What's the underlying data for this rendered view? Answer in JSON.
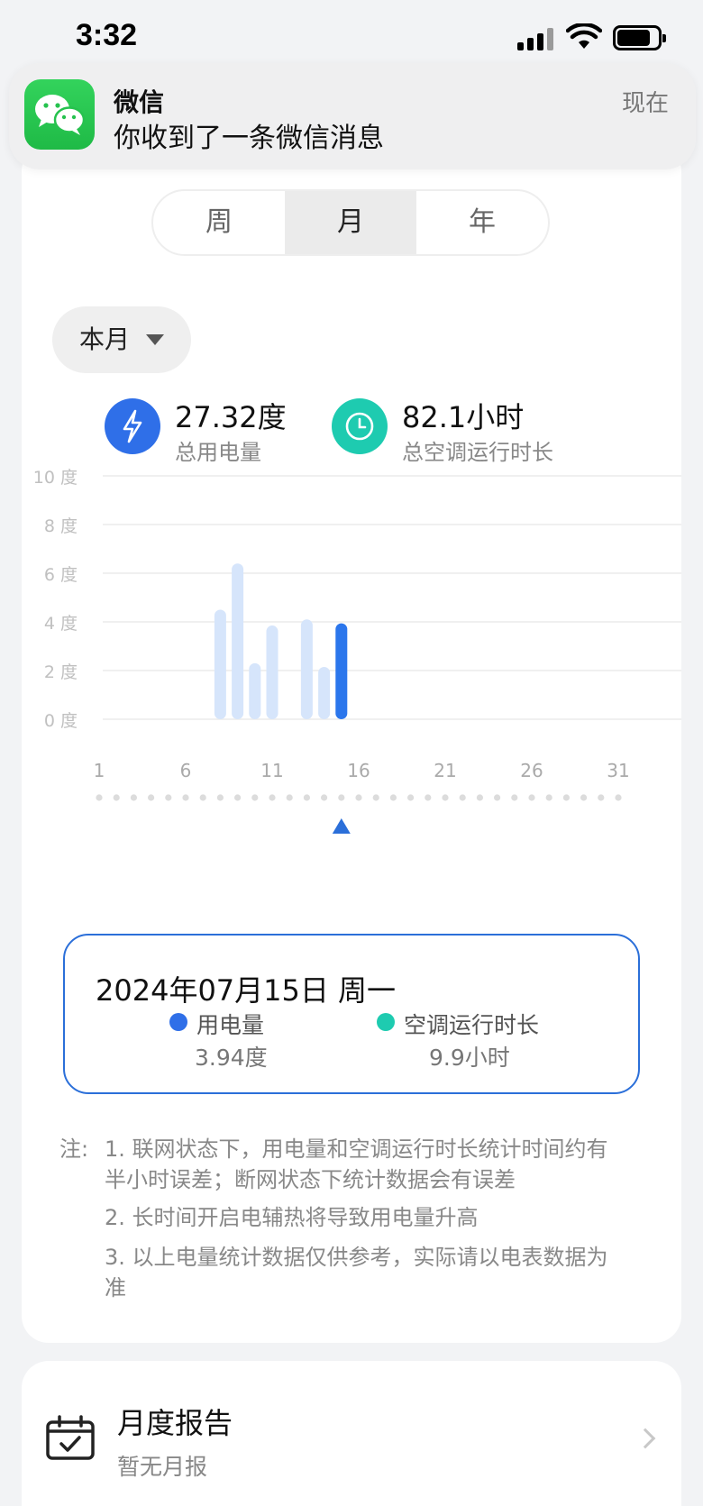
{
  "status_bar": {
    "time": "3:32"
  },
  "notification": {
    "app": "微信",
    "message": "你收到了一条微信消息",
    "time": "现在",
    "icon": "wechat-icon"
  },
  "tabs": [
    {
      "label": "周",
      "active": false
    },
    {
      "label": "月",
      "active": true
    },
    {
      "label": "年",
      "active": false
    }
  ],
  "period_selector": {
    "label": "本月",
    "icon": "caret-down-icon"
  },
  "stats": {
    "power": {
      "value": "27.32度",
      "label": "总用电量",
      "icon": "lightning-icon",
      "color": "#2f6fe8"
    },
    "runtime": {
      "value": "82.1小时",
      "label": "总空调运行时长",
      "icon": "clock-icon",
      "color": "#1ecbb0"
    }
  },
  "chart_data": {
    "type": "bar",
    "y_ticks": [
      "10 度",
      "8 度",
      "6 度",
      "4 度",
      "2 度",
      "0 度"
    ],
    "ylim": [
      0,
      10
    ],
    "x_ticks": [
      "1",
      "6",
      "11",
      "16",
      "21",
      "26",
      "31"
    ],
    "xlim": [
      1,
      31
    ],
    "x": [
      8,
      9,
      10,
      11,
      13,
      14,
      15
    ],
    "values": [
      4.5,
      6.4,
      2.3,
      3.85,
      4.1,
      2.15,
      3.94
    ],
    "selected_day": 15,
    "colors": {
      "normal": "#d6e5fb",
      "selected": "#2b76ec",
      "grid": "#ececec",
      "tick": "#c0c0c0",
      "marker": "#2b6fd9"
    }
  },
  "detail": {
    "date": "2024年07月15日  周一",
    "power_label": "用电量",
    "power_value": "3.94度",
    "power_color": "#2f6fe8",
    "runtime_label": "空调运行时长",
    "runtime_value": "9.9小时",
    "runtime_color": "#1ecbb0"
  },
  "notes": {
    "prefix": "注:",
    "items": [
      "1. 联网状态下，用电量和空调运行时长统计时间约有半小时误差；断网状态下统计数据会有误差",
      "2. 长时间开启电辅热将导致用电量升高",
      "3. 以上电量统计数据仅供参考，实际请以电表数据为准"
    ]
  },
  "report": {
    "title": "月度报告",
    "subtitle": "暂无月报",
    "icon": "calendar-check-icon"
  }
}
